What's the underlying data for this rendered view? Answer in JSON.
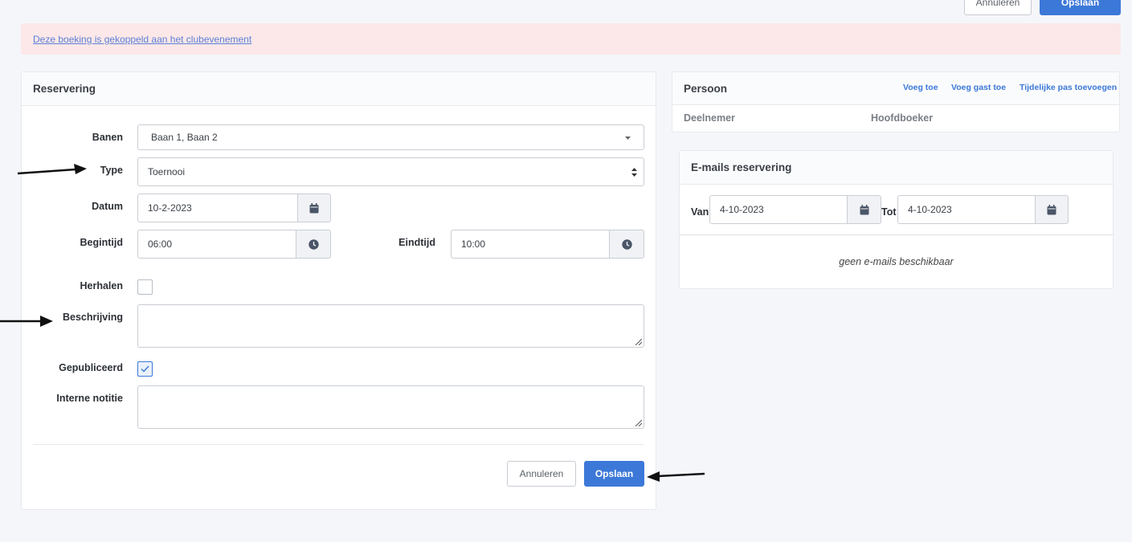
{
  "top_bar": {
    "cancel_label": "Annuleren",
    "save_label": "Opslaan"
  },
  "alert": {
    "link_text": "Deze boeking is gekoppeld aan het clubevenement"
  },
  "reservation": {
    "title": "Reservering",
    "fields": {
      "banen_label": "Banen",
      "banen_value": "Baan 1, Baan 2",
      "type_label": "Type",
      "type_value": "Toernooi",
      "datum_label": "Datum",
      "datum_value": "10-2-2023",
      "begintijd_label": "Begintijd",
      "begintijd_value": "06:00",
      "eindtijd_label": "Eindtijd",
      "eindtijd_value": "10:00",
      "herhalen_label": "Herhalen",
      "beschrijving_label": "Beschrijving",
      "gepubliceerd_label": "Gepubliceerd",
      "interne_notitie_label": "Interne notitie"
    },
    "cancel_label": "Annuleren",
    "save_label": "Opslaan"
  },
  "persoon": {
    "title": "Persoon",
    "links": [
      "Voeg toe",
      "Voeg gast toe",
      "Tijdelijke pas toevoegen"
    ],
    "columns": [
      "Deelnemer",
      "Hoofdboeker"
    ]
  },
  "emails": {
    "title": "E-mails reservering",
    "van_label": "Van",
    "van_value": "4-10-2023",
    "tot_label": "Tot",
    "tot_value": "4-10-2023",
    "empty_text": "geen e-mails beschikbaar"
  },
  "icons": [
    "calendar-icon",
    "clock-icon",
    "caret-down-icon",
    "sort-icon",
    "check-icon",
    "annotation-arrow-icon"
  ],
  "colors": {
    "primary": "#3c78d8",
    "alert_bg": "#fce8e8",
    "link": "#5b7fd6"
  }
}
